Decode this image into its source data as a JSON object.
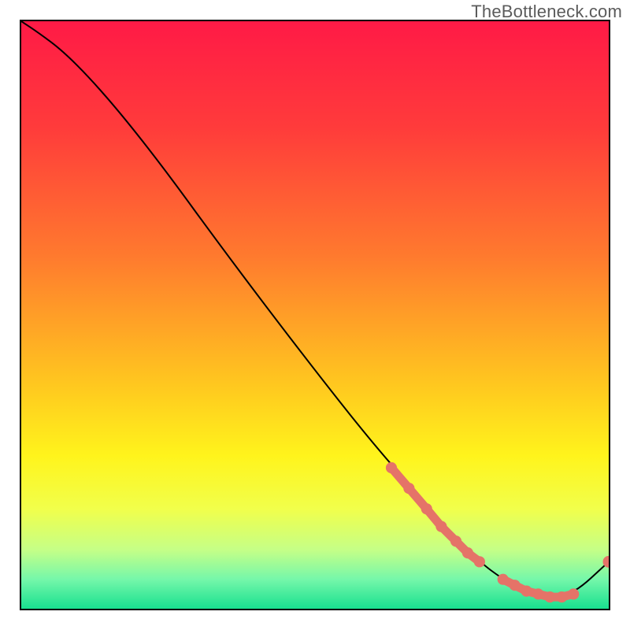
{
  "watermark": "TheBottleneck.com",
  "colors": {
    "frame_border": "#000000",
    "curve_stroke": "#000000",
    "marker_fill": "#e57368",
    "gradient_stops": [
      {
        "offset": 0.0,
        "color": "#ff1a46"
      },
      {
        "offset": 0.18,
        "color": "#ff3b3b"
      },
      {
        "offset": 0.4,
        "color": "#ff7a2e"
      },
      {
        "offset": 0.62,
        "color": "#ffc81f"
      },
      {
        "offset": 0.74,
        "color": "#fff41c"
      },
      {
        "offset": 0.83,
        "color": "#f1ff4b"
      },
      {
        "offset": 0.9,
        "color": "#c5ff87"
      },
      {
        "offset": 0.95,
        "color": "#75f7aa"
      },
      {
        "offset": 1.0,
        "color": "#18e08f"
      }
    ]
  },
  "chart_data": {
    "type": "line",
    "title": "",
    "xlabel": "",
    "ylabel": "",
    "xlim": [
      0,
      100
    ],
    "ylim": [
      0,
      100
    ],
    "note": "Axes have no visible numeric ticks; x/y are normalized percentages of plot width/height with origin at bottom-left.",
    "series": [
      {
        "name": "bottleneck-curve",
        "kind": "line",
        "x": [
          0.0,
          3.0,
          7.0,
          12.0,
          18.0,
          25.0,
          33.0,
          42.0,
          52.0,
          60.0,
          67.0,
          73.0,
          78.0,
          82.0,
          86.0,
          90.0,
          94.0,
          100.0
        ],
        "y": [
          100.0,
          98.0,
          95.0,
          90.0,
          83.0,
          74.0,
          63.0,
          51.0,
          38.0,
          28.0,
          20.0,
          13.0,
          8.0,
          5.0,
          3.0,
          2.0,
          2.5,
          8.0
        ]
      },
      {
        "name": "highlight-lower-segment",
        "kind": "thick-line-markers",
        "x": [
          63.0,
          66.0,
          69.0,
          71.5,
          74.0,
          76.0,
          78.0
        ],
        "y": [
          24.0,
          20.5,
          17.0,
          14.0,
          11.5,
          9.5,
          8.0
        ]
      },
      {
        "name": "highlight-flat-segment",
        "kind": "thick-line-markers",
        "x": [
          82.0,
          84.0,
          86.0,
          88.0,
          90.0,
          92.0,
          94.0
        ],
        "y": [
          5.0,
          4.0,
          3.0,
          2.5,
          2.0,
          2.0,
          2.5
        ]
      },
      {
        "name": "end-dot",
        "kind": "marker",
        "x": [
          100.0
        ],
        "y": [
          8.0
        ]
      }
    ]
  }
}
